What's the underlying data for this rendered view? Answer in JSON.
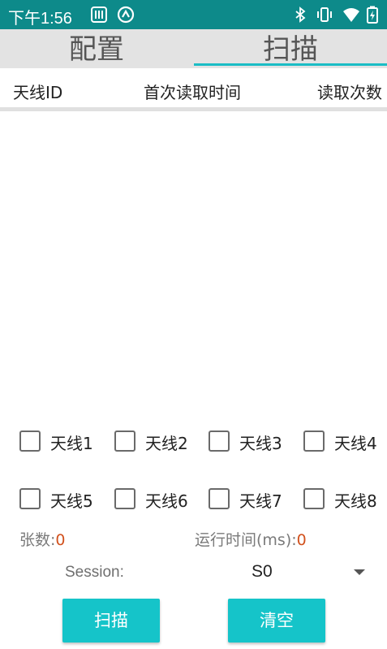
{
  "status_bar": {
    "time": "下午1:56",
    "icons": [
      "sim-card-icon",
      "sync-icon",
      "bluetooth-icon",
      "vibrate-icon",
      "wifi-icon",
      "battery-charging-icon"
    ]
  },
  "tabs": [
    {
      "label": "配置",
      "selected": false
    },
    {
      "label": "扫描",
      "selected": true
    }
  ],
  "table": {
    "columns": [
      "天线ID",
      "首次读取时间",
      "读取次数"
    ],
    "rows": []
  },
  "antennas": [
    {
      "label": "天线1",
      "checked": false
    },
    {
      "label": "天线2",
      "checked": false
    },
    {
      "label": "天线3",
      "checked": false
    },
    {
      "label": "天线4",
      "checked": false
    },
    {
      "label": "天线5",
      "checked": false
    },
    {
      "label": "天线6",
      "checked": false
    },
    {
      "label": "天线7",
      "checked": false
    },
    {
      "label": "天线8",
      "checked": false
    }
  ],
  "stats": {
    "count_label": "张数:",
    "count_value": "0",
    "runtime_label": "运行时间(ms):",
    "runtime_value": "0"
  },
  "session": {
    "label": "Session:",
    "value": "S0"
  },
  "buttons": {
    "scan": "扫描",
    "clear": "清空"
  },
  "colors": {
    "status_bar": "#0d8a8a",
    "accent": "#15c4c9",
    "value_text": "#d2521e"
  }
}
